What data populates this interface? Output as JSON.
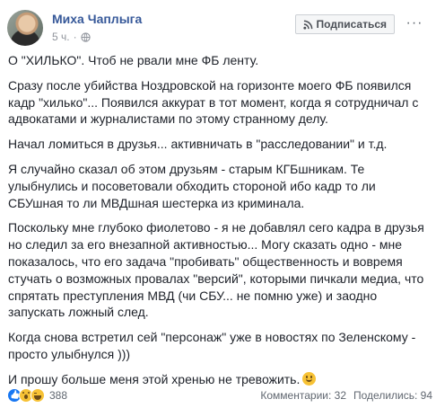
{
  "post": {
    "author": "Миха Чаплыга",
    "time": "5 ч.",
    "time_separator": "·",
    "subscribe_label": "Подписаться",
    "more_label": "···",
    "paragraphs": [
      "О \"ХИЛЬКО\". Чтоб не рвали мне ФБ ленту.",
      "Сразу после убийства Ноздровской на горизонте моего ФБ появился кадр \"хилько\"... Появился аккурат в тот момент, когда я сотрудничал с адвокатами и журналистами по этому странному делу.",
      "Начал ломиться в друзья... активничать в \"расследовании\" и т.д.",
      "Я случайно сказал об этом друзьям - старым КГБшникам. Те улыбнулись и посоветовали обходить стороной ибо кадр то ли СБУшная то ли МВДшная шестерка из криминала.",
      "Поскольку мне глубоко фиолетово - я не добавлял сего кадра в друзья но следил за его внезапной активностью... Могу сказать одно - мне показалось, что его задача \"пробивать\" общественность и вовремя стучать о возможных провалах \"версий\", которыми пичкали медиа, что спрятать преступления МВД (чи СБУ... не помню уже) и заодно запускать ложный след.",
      "Когда снова встретил сей \"персонаж\" уже в новостях по Зеленскому - просто улыбнулся )))"
    ],
    "last_paragraph": "И прошу больше меня этой хренью не тревожить."
  },
  "footer": {
    "reactions_count": "388",
    "comments": "Комментарии: 32",
    "shares": "Поделились: 94"
  },
  "icons": {
    "reactions": [
      "like-icon",
      "wow-icon",
      "laugh-icon"
    ],
    "emoji": "smile-emoji-icon",
    "privacy": "globe-icon"
  },
  "colors": {
    "author_link": "#365899",
    "like_blue": "#1877f2",
    "emoji_yellow": "#f7c235"
  }
}
